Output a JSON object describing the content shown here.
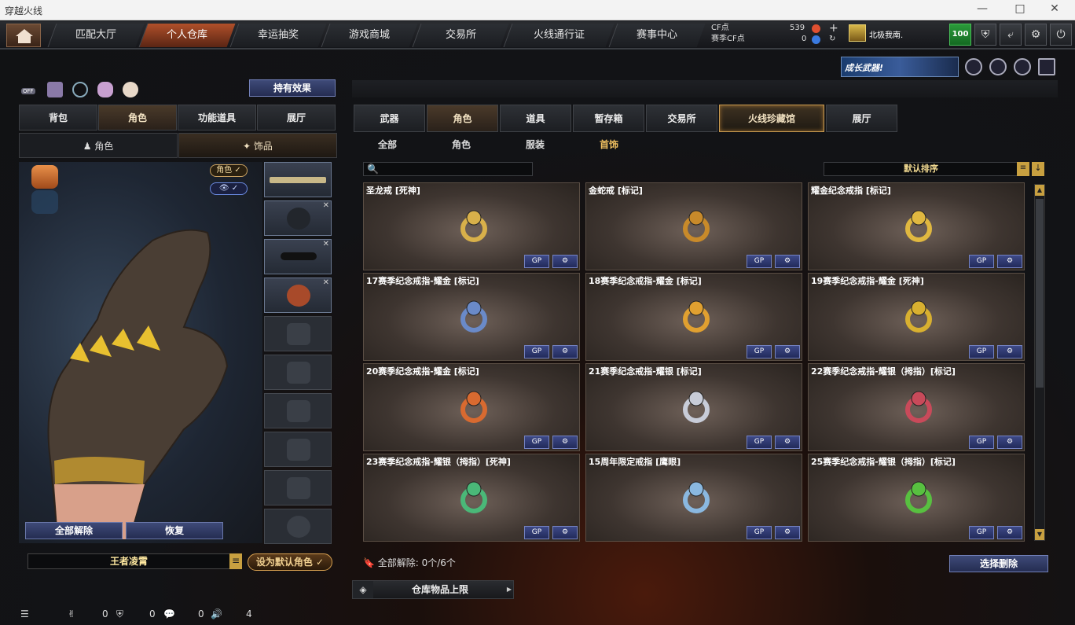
{
  "window": {
    "title": "穿越火线"
  },
  "topnav": {
    "tabs": [
      {
        "label": "匹配大厅"
      },
      {
        "label": "个人仓库"
      },
      {
        "label": "幸运抽奖"
      },
      {
        "label": "游戏商城"
      },
      {
        "label": "交易所"
      },
      {
        "label": "火线通行证"
      },
      {
        "label": "赛事中心"
      }
    ],
    "active_tab": "个人仓库"
  },
  "currency": {
    "cf_label": "CF点",
    "cf_value": "539",
    "match_label": "赛季CF点",
    "match_value": "0"
  },
  "user": {
    "name": "北极我南."
  },
  "level": "100",
  "promo": {
    "text": "成长武器!"
  },
  "left": {
    "effects_button": "持有效果",
    "tabs": [
      "背包",
      "角色",
      "功能道具",
      "展厅"
    ],
    "active_tab": "角色",
    "subtabs": [
      "角色",
      "饰品"
    ],
    "active_subtab": "饰品",
    "chip_role": "角色 ✓",
    "chip_eye": "👁 ✓",
    "unequip_all": "全部解除",
    "restore": "恢复",
    "character_name": "王者凌霄",
    "set_default": "设为默认角色 ✓",
    "off_label": "OFF"
  },
  "right": {
    "tabs": [
      "武器",
      "角色",
      "道具",
      "暂存箱",
      "交易所",
      "火线珍藏馆",
      "展厅"
    ],
    "active_tab": "角色",
    "highlight_tab": "火线珍藏馆",
    "filters": [
      "全部",
      "角色",
      "服装",
      "首饰"
    ],
    "active_filter": "首饰",
    "search_placeholder": "",
    "sort": "默认排序",
    "items": [
      {
        "name": "圣龙戒 [死神]",
        "color": "#d8b04a"
      },
      {
        "name": "金蛇戒 [标记]",
        "color": "#c88a2a"
      },
      {
        "name": "耀金纪念戒指 [标记]",
        "color": "#e0b840"
      },
      {
        "name": "17赛季纪念戒指-耀金 [标记]",
        "color": "#6a8ac8"
      },
      {
        "name": "18赛季纪念戒指-耀金 [标记]",
        "color": "#e0a030"
      },
      {
        "name": "19赛季纪念戒指-耀金 [死神]",
        "color": "#d8b030"
      },
      {
        "name": "20赛季纪念戒指-耀金 [标记]",
        "color": "#d86a30"
      },
      {
        "name": "21赛季纪念戒指-耀银 [标记]",
        "color": "#c8ccd8"
      },
      {
        "name": "22赛季纪念戒指-耀银（拇指）[标记]",
        "color": "#c84a5a"
      },
      {
        "name": "23赛季纪念戒指-耀银（拇指）[死神]",
        "color": "#4ab878"
      },
      {
        "name": "15周年限定戒指 [鹰眼]",
        "color": "#8ab8e0"
      },
      {
        "name": "25赛季纪念戒指-耀银（拇指）[标记]",
        "color": "#58c040"
      }
    ],
    "item_btn_gp": "GP",
    "item_btn_gear": "⚙",
    "unequip_count": "全部解除: 0个/6个",
    "batch_delete": "选择删除"
  },
  "storage_limit": "仓库物品上限",
  "status": {
    "a": "0",
    "b": "0",
    "c": "0",
    "d": "4"
  }
}
